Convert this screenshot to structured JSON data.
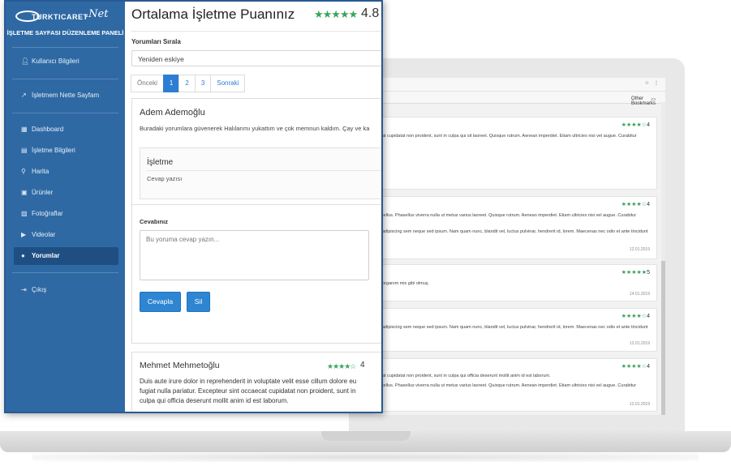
{
  "sidebar": {
    "logo_text": "TURKTICARET",
    "logo_net": ".Net",
    "panel_title": "İŞLETME SAYFASI DÜZENLEME PANELİ",
    "items": [
      {
        "label": "Kullanıcı Bilgileri",
        "icon": "user-icon"
      },
      {
        "label": "İşletmem Nette Sayfam",
        "icon": "external-link-icon"
      },
      {
        "label": "Dashboard",
        "icon": "dashboard-icon"
      },
      {
        "label": "İşletme Bilgileri",
        "icon": "building-icon"
      },
      {
        "label": "Harita",
        "icon": "map-marker-icon"
      },
      {
        "label": "Ürünler",
        "icon": "box-icon"
      },
      {
        "label": "Fotoğraflar",
        "icon": "image-icon"
      },
      {
        "label": "Videolar",
        "icon": "video-icon"
      },
      {
        "label": "Yorumlar",
        "icon": "comment-icon",
        "active": true
      },
      {
        "label": "Çıkış",
        "icon": "logout-icon"
      }
    ]
  },
  "main": {
    "title": "Ortalama İşletme Puanınız",
    "rating_stars": "★★★★★",
    "rating_value": "4.8",
    "sort_label": "Yorumları Sırala",
    "sort_value": "Yeniden eskiye",
    "pager": [
      "Önceki",
      "1",
      "2",
      "3",
      "Sonraki"
    ],
    "review1": {
      "name": "Adem Ademoğlu",
      "text": "Buradaki yorumlara güvenerek Halılarımı yukattım ve çok memnun kaldım. Çay ve ka",
      "business_title": "İşletme",
      "business_reply": "Cevap yazısı",
      "answer_label": "Cevabınız",
      "answer_placeholder": "Bu yoruma cevap yazın...",
      "reply_button": "Cevapla",
      "delete_button": "Sil"
    },
    "review2": {
      "name": "Mehmet Mehmetoğlu",
      "stars": "★★★★☆",
      "score": "4",
      "lines": [
        "Duis aute irure dolor in reprehenderit in voluptate velit esse cillum dolore eu",
        "fugiat nulla pariatur. Excepteur sint occaecat cupidatat non proident, sunt in",
        "culpa qui officia deserunt mollit anim id est laborum."
      ]
    }
  },
  "background_browser": {
    "bookmarks": "Other Bookmarks",
    "cards": [
      {
        "stars": "★★★★☆",
        "score": "4",
        "lines": [
          "at cupidatat non proident, sunt in culpa qui sit laoreet. Quisque rutrum. Aenean imperdiet. Etiam ultricies nisi vel augue. Curabitur"
        ],
        "date": ""
      },
      {
        "stars": "★★★★☆",
        "score": "4",
        "lines": [
          "tellus. Phasellus viverra nulla ut metus varius laoreet. Quisque rutrum. Aenean imperdiet. Etiam ultricies nisi vel augue. Curabitur",
          "adipiscing sem neque sed ipsum. Nam quam nunc, blandit vel, luctus pulvinar, hendrerit id, lorem. Maecenas nec odio et ante tincidunt"
        ],
        "date": "12.01.2019"
      },
      {
        "stars": "★★★★★",
        "score": "5",
        "lines": [
          "organım mis gibi olmuş."
        ],
        "date": "14.01.2019"
      },
      {
        "stars": "★★★★☆",
        "score": "4",
        "lines": [
          "adipiscing sem neque sed ipsum. Nam quam nunc, blandit vel, luctus pulvinar, hendrerit id, lorem. Maecenas nec odio et ante tincidunt"
        ],
        "date": "12.01.2019"
      },
      {
        "stars": "★★★★☆",
        "score": "4",
        "lines": [
          "at cupidatat non proident, sunt in culpa qui officia deserunt mollit anim id est laborum.",
          "tellus. Phasellus viverra nulla ut metus varius laoreet. Quisque rutrum. Aenean imperdiet. Etiam ultricies nisi vel augue. Curabitur"
        ],
        "date": "12.01.2019"
      }
    ]
  }
}
